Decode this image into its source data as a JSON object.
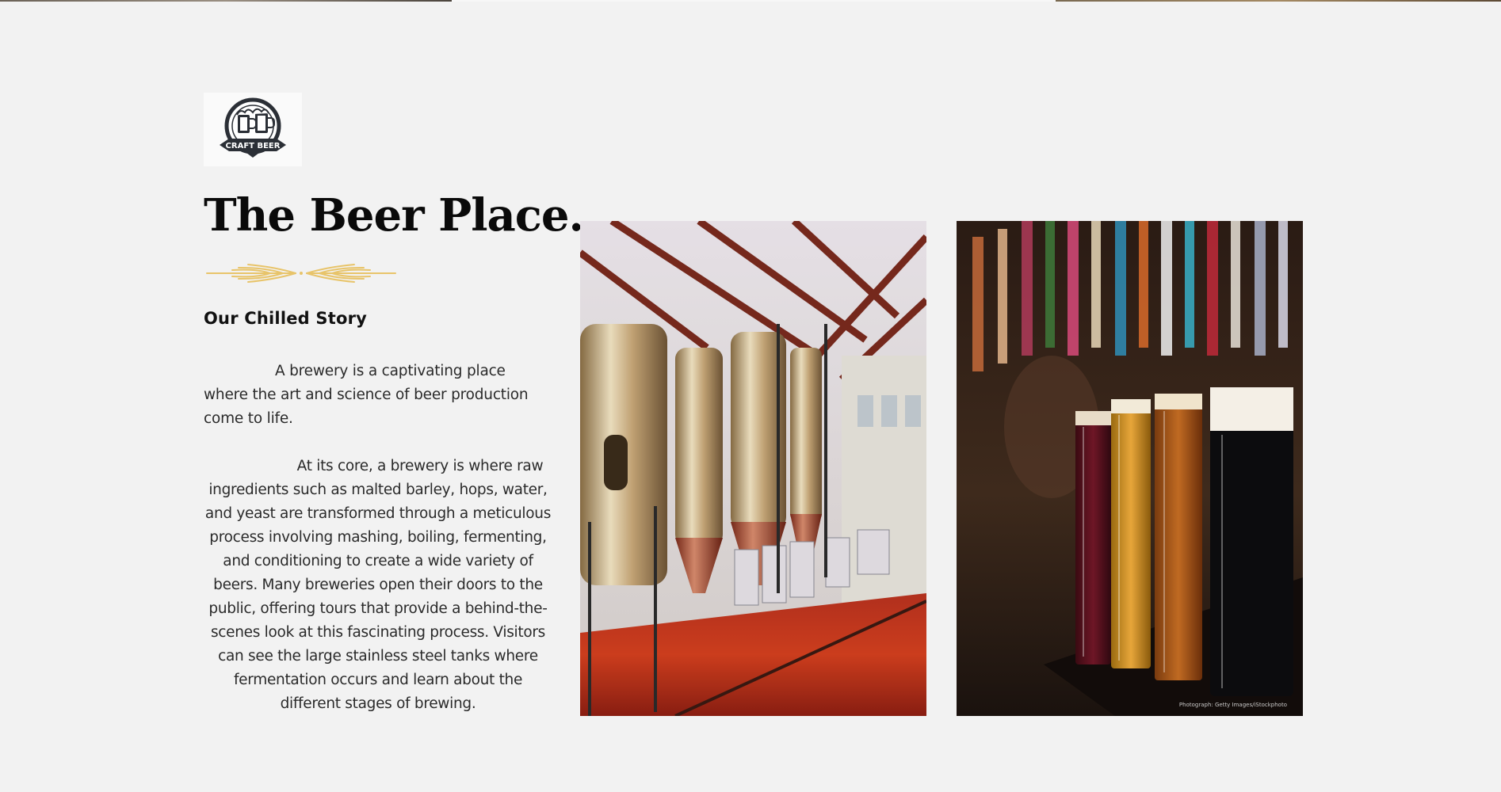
{
  "logo": {
    "icon": "beer-mugs-badge-icon",
    "badge_text": "CRAFT BEER"
  },
  "hero": {
    "title": "The Beer Place.",
    "ornament_icon": "wheat-divider-icon",
    "subtitle": "Our Chilled Story",
    "paragraph_1": "A brewery is a captivating place where the art and science of beer production come to life.",
    "paragraph_2": "At its core, a brewery is where raw ingredients such as malted barley, hops, water, and yeast are transformed through a meticulous process involving mashing, boiling, fermenting, and conditioning to create a wide variety of beers. Many breweries open their doors to the public, offering tours that provide a behind-the-scenes look at this fascinating process. Visitors can see the large stainless steel tanks where fermentation occurs and learn about the different stages of brewing."
  },
  "images": {
    "brewery_photo": "brewery-interior-image",
    "beer_photo": "beer-flight-image",
    "beer_photo_credit": "Photograph: Getty Images/iStockphoto"
  },
  "colors": {
    "background": "#f2f2f2",
    "ornament": "#e8c46a",
    "title": "#0a0a0a"
  }
}
